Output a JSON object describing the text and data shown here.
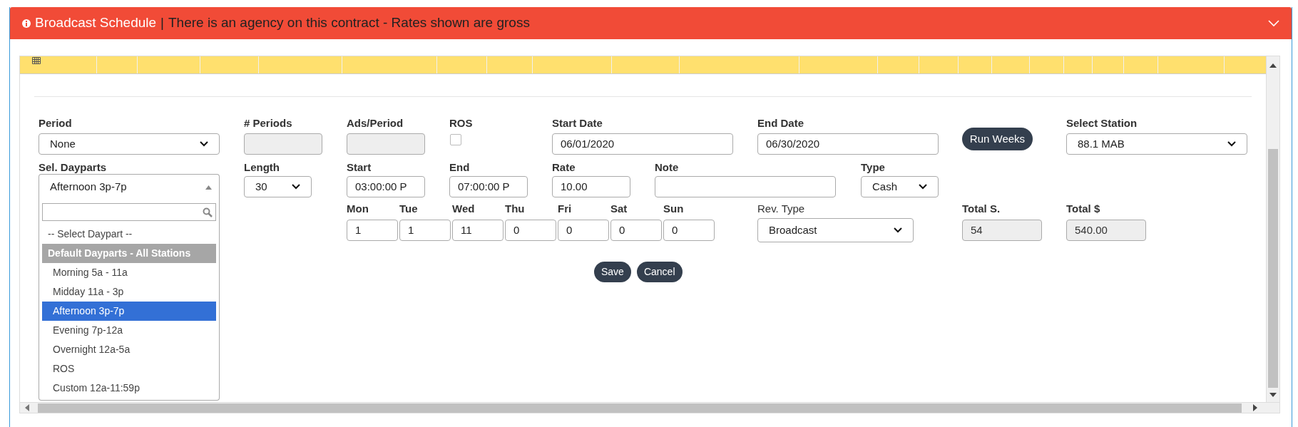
{
  "header": {
    "title": "Broadcast Schedule",
    "separator": "|",
    "message": "There is an agency on this contract - Rates shown are gross",
    "collapsed": false
  },
  "form": {
    "period": {
      "label": "Period",
      "kind": "select",
      "value": "None"
    },
    "periods_count": {
      "label": "# Periods",
      "kind": "readonly"
    },
    "ads_per_period": {
      "label": "Ads/Period",
      "kind": "readonly"
    },
    "ros": {
      "label": "ROS",
      "kind": "checkbox",
      "checked": false
    },
    "start_date": {
      "label": "Start Date",
      "kind": "text",
      "value": "06/01/2020"
    },
    "end_date": {
      "label": "End Date",
      "kind": "text",
      "value": "06/30/2020"
    },
    "run_weeks": {
      "label": "Run Weeks",
      "kind": "button"
    },
    "select_station": {
      "label": "Select Station",
      "kind": "select",
      "value": "88.1 MAB"
    },
    "dayparts": {
      "label": "Sel. Dayparts",
      "value": "Afternoon 3p-7p",
      "open": true,
      "options": [
        {
          "label": "-- Select Daypart --",
          "kind": "placeholder",
          "selected": false
        },
        {
          "label": "Default Dayparts - All Stations",
          "kind": "group",
          "selected": false
        },
        {
          "label": "Morning 5a - 11a",
          "kind": "option",
          "selected": false
        },
        {
          "label": "Midday 11a - 3p",
          "kind": "option",
          "selected": false
        },
        {
          "label": "Afternoon 3p-7p",
          "kind": "option",
          "selected": true
        },
        {
          "label": "Evening 7p-12a",
          "kind": "option",
          "selected": false
        },
        {
          "label": "Overnight 12a-5a",
          "kind": "option",
          "selected": false
        },
        {
          "label": "ROS",
          "kind": "option",
          "selected": false
        },
        {
          "label": "Custom 12a-11:59p",
          "kind": "option",
          "selected": false
        }
      ]
    },
    "length": {
      "label": "Length",
      "kind": "select",
      "value": "30"
    },
    "start": {
      "label": "Start",
      "kind": "text",
      "value": "03:00:00 P"
    },
    "end": {
      "label": "End",
      "kind": "text",
      "value": "07:00:00 P"
    },
    "rate": {
      "label": "Rate",
      "kind": "text",
      "value": "10.00"
    },
    "note": {
      "label": "Note",
      "kind": "text"
    },
    "type": {
      "label": "Type",
      "kind": "select",
      "value": "Cash"
    },
    "days": [
      {
        "label": "Mon",
        "value": "1"
      },
      {
        "label": "Tue",
        "value": "1"
      },
      {
        "label": "Wed",
        "value": "11"
      },
      {
        "label": "Thu",
        "value": "0"
      },
      {
        "label": "Fri",
        "value": "0"
      },
      {
        "label": "Sat",
        "value": "0"
      },
      {
        "label": "Sun",
        "value": "0"
      }
    ],
    "rev_type": {
      "label": "Rev. Type",
      "kind": "select",
      "value": "Broadcast"
    },
    "total_spots": {
      "label": "Total S.",
      "kind": "readonly",
      "value": "54"
    },
    "total_amount": {
      "label": "Total $",
      "kind": "readonly",
      "value": "540.00"
    }
  },
  "buttons": [
    {
      "label": "Save"
    },
    {
      "label": "Cancel"
    }
  ]
}
